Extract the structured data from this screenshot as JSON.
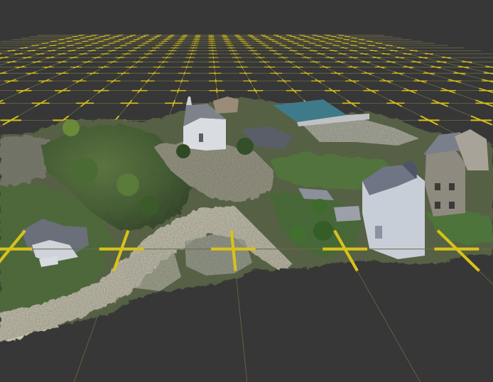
{
  "viewer": {
    "background_color": "#373737",
    "grid_color": "#6b6a47",
    "axis_color": "#d8c21a"
  }
}
